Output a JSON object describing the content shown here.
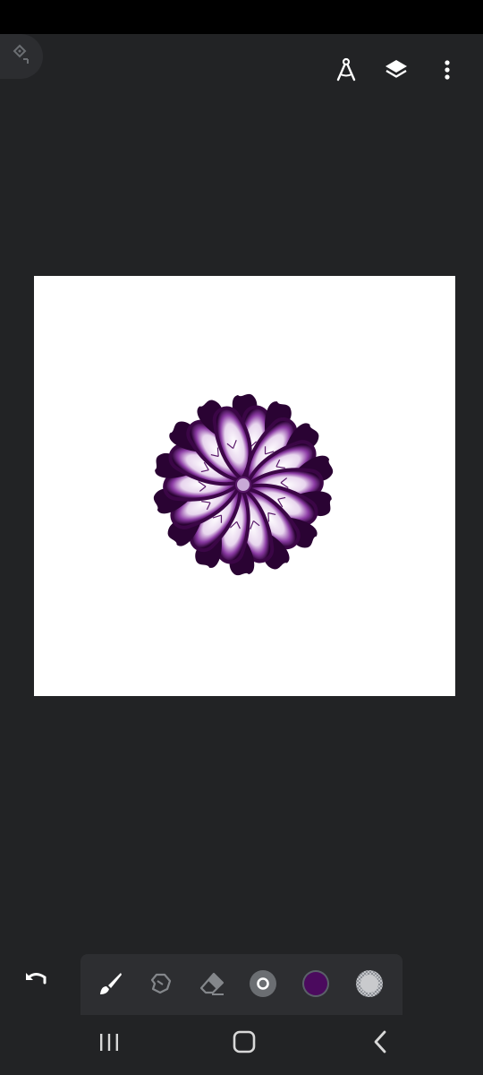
{
  "app": {
    "accent_color": "#4b0a5e",
    "background_color": "#222325"
  },
  "top_toolbar": {
    "icons": [
      "menu-icon",
      "ruler-compass-icon",
      "layers-icon",
      "more-vert-icon"
    ]
  },
  "canvas": {
    "background": "#ffffff",
    "artwork": "purple mandala"
  },
  "bottom_toolbar": {
    "tools": [
      "brush-icon",
      "smudge-icon",
      "eraser-icon",
      "brush-size-icon",
      "color-swatch-icon",
      "opacity-icon"
    ],
    "current_color": "#4b0a5e"
  },
  "navigation": {
    "icons": [
      "recent-apps-icon",
      "home-icon",
      "back-icon"
    ]
  }
}
